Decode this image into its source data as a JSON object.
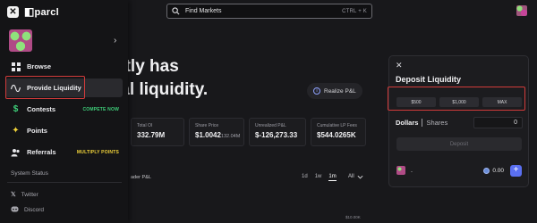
{
  "brand": {
    "name": "parcl"
  },
  "search": {
    "label": "Find Markets",
    "shortcut": "CTRL + K"
  },
  "sidebar": {
    "items": [
      {
        "label": "Browse",
        "icon": "grid-icon",
        "badge": ""
      },
      {
        "label": "Provide Liquidity",
        "icon": "wave-icon",
        "badge": ""
      },
      {
        "label": "Contests",
        "icon": "dollar-icon",
        "badge": "COMPETE NOW"
      },
      {
        "label": "Points",
        "icon": "sparkle-icon",
        "badge": ""
      },
      {
        "label": "Referrals",
        "icon": "users-icon",
        "badge": "MULTIPLY POINTS"
      }
    ],
    "system_status": "System Status",
    "socials": [
      {
        "label": "Twitter",
        "icon": "x-logo-icon"
      },
      {
        "label": "Discord",
        "icon": "discord-icon"
      }
    ]
  },
  "hero": {
    "line1": "ntly has",
    "line2": "tal liquidity."
  },
  "realize_button": "Realize P&L",
  "stats": [
    {
      "label": "Total OI",
      "value": "332.79M",
      "sub": ""
    },
    {
      "label": "Share Price",
      "value": "$1.0042",
      "sub": "132.04M"
    },
    {
      "label": "Unrealized P&L",
      "value": "$-126,273.33",
      "sub": ""
    },
    {
      "label": "Cumulative LP Fees",
      "value": "$544.0265K",
      "sub": ""
    }
  ],
  "chart": {
    "title": "ader P&L",
    "ranges": [
      "1d",
      "1w",
      "1m"
    ],
    "active_range": "1m",
    "filter": "All",
    "axis_tick": "$10.00K"
  },
  "deposit": {
    "title": "Deposit Liquidity",
    "presets": [
      "$500",
      "$1,000",
      "MAX"
    ],
    "mode_dollars": "Dollars",
    "mode_shares": "Shares",
    "amount": "0",
    "deposit_button": "Deposit",
    "position_label": ".",
    "position_value": "0.00"
  },
  "colors": {
    "accent": "#5a6ff0",
    "contest_badge": "#3fd07a",
    "referral_badge": "#f2d43a",
    "highlight": "#d23b3b"
  }
}
